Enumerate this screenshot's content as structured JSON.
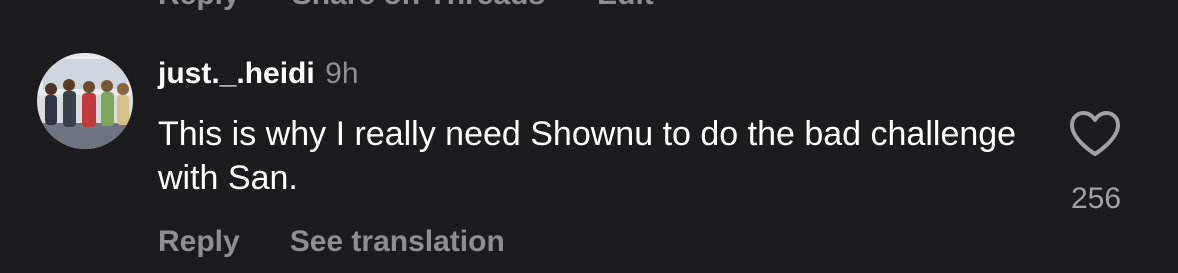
{
  "top_actions": [
    "Reply",
    "Share on Threads",
    "Edit"
  ],
  "comment": {
    "username": "just._.heidi",
    "timestamp": "9h",
    "text": "This is why I really need Shownu to do the bad challenge with San.",
    "like_count": "256",
    "actions": {
      "reply_label": "Reply",
      "translate_label": "See translation"
    }
  },
  "colors": {
    "background": "#1c1c1e",
    "primary_text": "#ffffff",
    "secondary_text": "#8e8e93"
  },
  "icons": {
    "like": "heart-outline-icon",
    "avatar": "profile-photo"
  }
}
